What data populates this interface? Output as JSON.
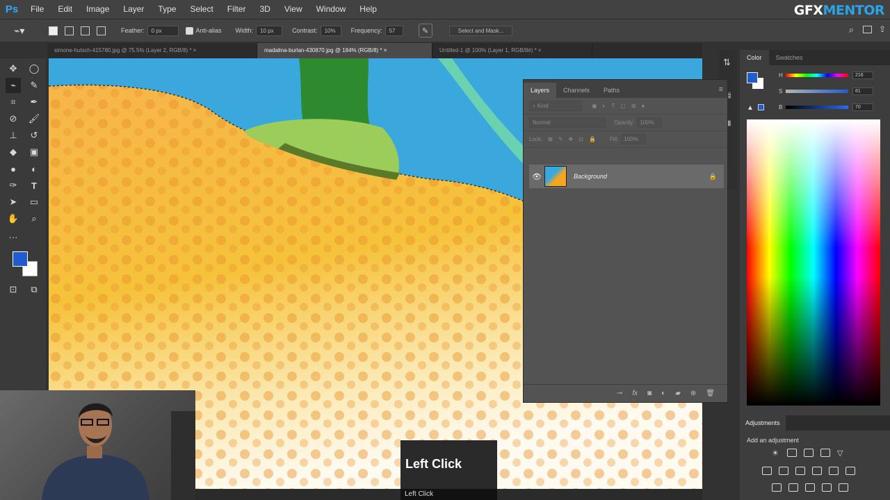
{
  "app": {
    "logo": "Ps",
    "brand_part1": "GFX",
    "brand_part2": "MENTOR"
  },
  "menu": [
    "File",
    "Edit",
    "Image",
    "Layer",
    "Type",
    "Select",
    "Filter",
    "3D",
    "View",
    "Window",
    "Help"
  ],
  "options": {
    "feather_label": "Feather:",
    "feather_value": "0 px",
    "antialias_label": "Anti-alias",
    "width_label": "Width:",
    "width_value": "10 px",
    "contrast_label": "Contrast:",
    "contrast_value": "10%",
    "frequency_label": "Frequency:",
    "frequency_value": "57",
    "select_mask_button": "Select and Mask..."
  },
  "tabs": [
    {
      "label": "simone-hutsch-415780.jpg @ 75.5% (Layer 2, RGB/8) *",
      "active": false
    },
    {
      "label": "madalina-burlan-430870.jpg @ 184% (RGB/8) *",
      "active": true
    },
    {
      "label": "Untitled-1 @ 100% (Layer 1, RGB/8#) *",
      "active": false
    }
  ],
  "tab_close": "×",
  "layers_panel": {
    "tabs": [
      "Layers",
      "Channels",
      "Paths"
    ],
    "kind_placeholder": "Kind",
    "blend_mode": "Normal",
    "opacity_label": "Opacity:",
    "opacity_value": "100%",
    "lock_label": "Lock:",
    "fill_label": "Fill:",
    "fill_value": "100%",
    "layer_name": "Background",
    "footer_icons": [
      "link-icon",
      "fx-icon",
      "mask-icon",
      "adjustment-icon",
      "folder-icon",
      "new-layer-icon",
      "trash-icon"
    ]
  },
  "color_panel": {
    "tabs": [
      "Color",
      "Swatches"
    ],
    "sliders": [
      {
        "label": "H",
        "value": "216"
      },
      {
        "label": "S",
        "value": "81"
      },
      {
        "label": "B",
        "value": "70"
      }
    ],
    "foreground": "#1f5ccf",
    "background": "#ffffff"
  },
  "adjustments": {
    "tab": "Adjustments",
    "hint": "Add an adjustment"
  },
  "overlay": {
    "title": "Left Click",
    "subtitle": "Left Click"
  },
  "colors": {
    "canvas_sky": "#3aa8dc",
    "orange": "#f4a623",
    "accent": "#31a8ff"
  }
}
